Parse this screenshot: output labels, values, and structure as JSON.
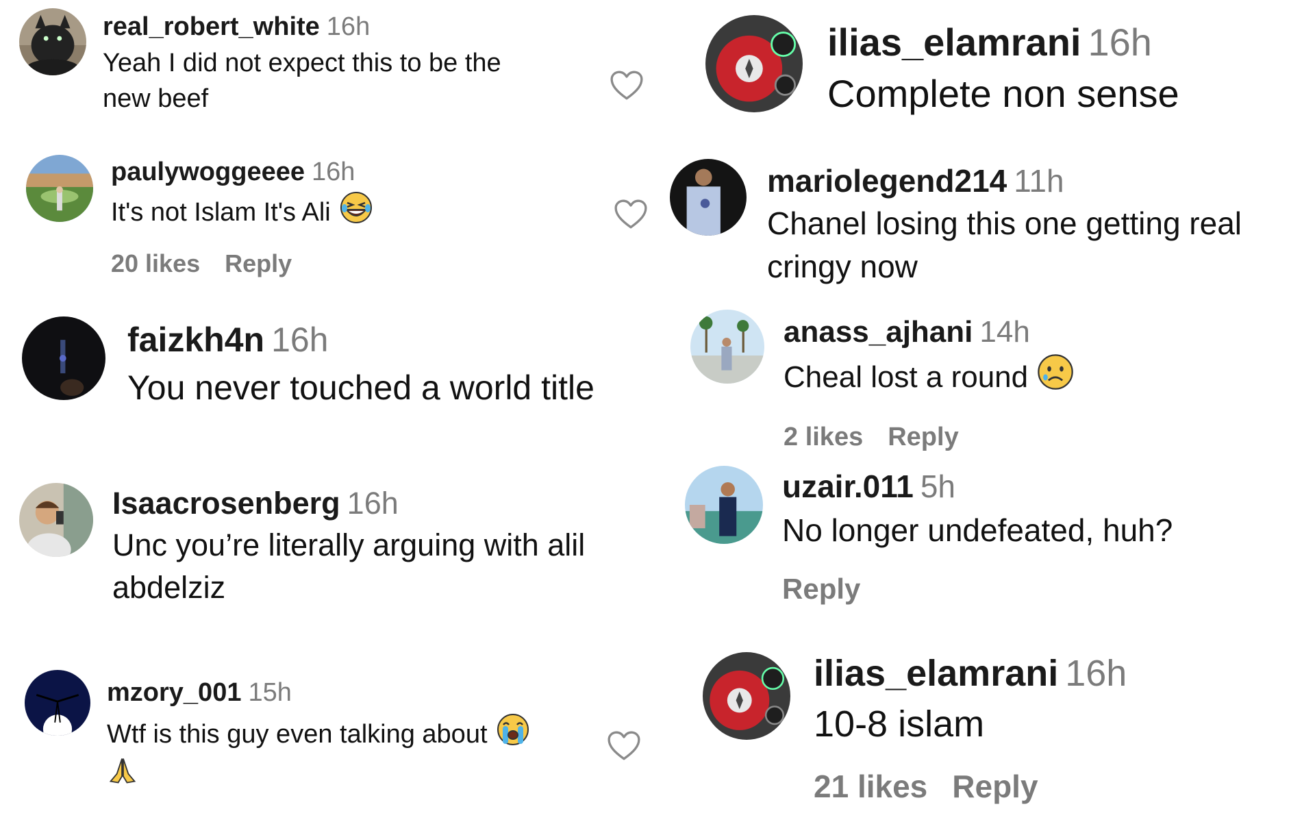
{
  "left_column": [
    {
      "username": "real_robert_white",
      "time": "16h",
      "text": "Yeah I did not expect this to be the new beef"
    },
    {
      "username": "paulywoggeeee",
      "time": "16h",
      "text": "It's not Islam It's Ali",
      "emoji_icon": "laughing-face-icon",
      "likes": "20 likes",
      "reply": "Reply"
    },
    {
      "username": "faizkh4n",
      "time": "16h",
      "text": "You never touched a world title"
    },
    {
      "username": "Isaacrosenberg",
      "time": "16h",
      "text": "Unc you’re literally arguing with alil abdelziz"
    },
    {
      "username": "mzory_001",
      "time": "15h",
      "text": "Wtf is this guy even talking about",
      "emoji_icon": "loudly-crying-face-icon",
      "emoji_icon_2": "folded-hands-icon"
    }
  ],
  "right_column": [
    {
      "username": "ilias_elamrani",
      "time": "16h",
      "text": "Complete non sense"
    },
    {
      "username": "mariolegend214",
      "time": "11h",
      "text": "Chanel losing this one getting real cringy now"
    },
    {
      "username": "anass_ajhani",
      "time": "14h",
      "text": "Cheal lost a round",
      "emoji_icon": "sad-face-icon",
      "likes": "2 likes",
      "reply": "Reply"
    },
    {
      "username": "uzair.011",
      "time": "5h",
      "text": "No longer undefeated, huh?",
      "reply": "Reply"
    },
    {
      "username": "ilias_elamrani",
      "time": "16h",
      "text": "10-8 islam",
      "likes": "21 likes",
      "reply": "Reply"
    }
  ],
  "icons": {
    "like": "heart-outline-icon"
  },
  "colors": {
    "text": "#111111",
    "muted": "#7b7b7b",
    "background": "#ffffff"
  }
}
